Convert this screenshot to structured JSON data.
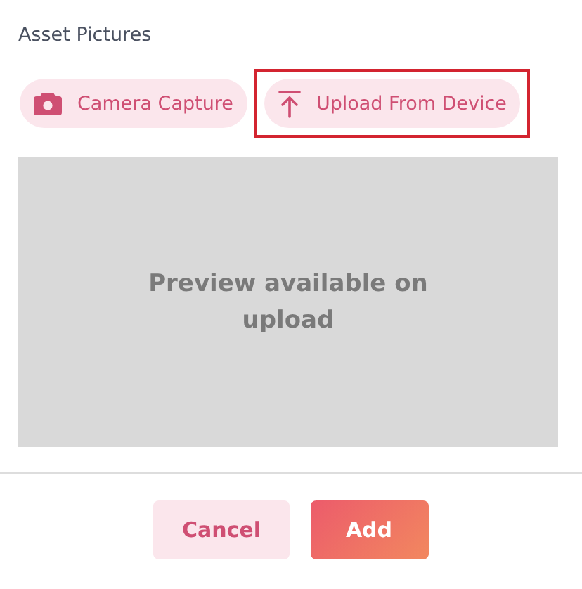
{
  "section_title": "Asset Pictures",
  "sources": [
    {
      "kind": "camera",
      "label": "Camera Capture",
      "highlighted": false
    },
    {
      "kind": "upload",
      "label": "Upload From Device",
      "highlighted": true
    }
  ],
  "preview": {
    "message": "Preview available on upload"
  },
  "buttons": [
    {
      "kind": "secondary",
      "label": "Cancel"
    },
    {
      "kind": "primary",
      "label": "Add"
    }
  ]
}
